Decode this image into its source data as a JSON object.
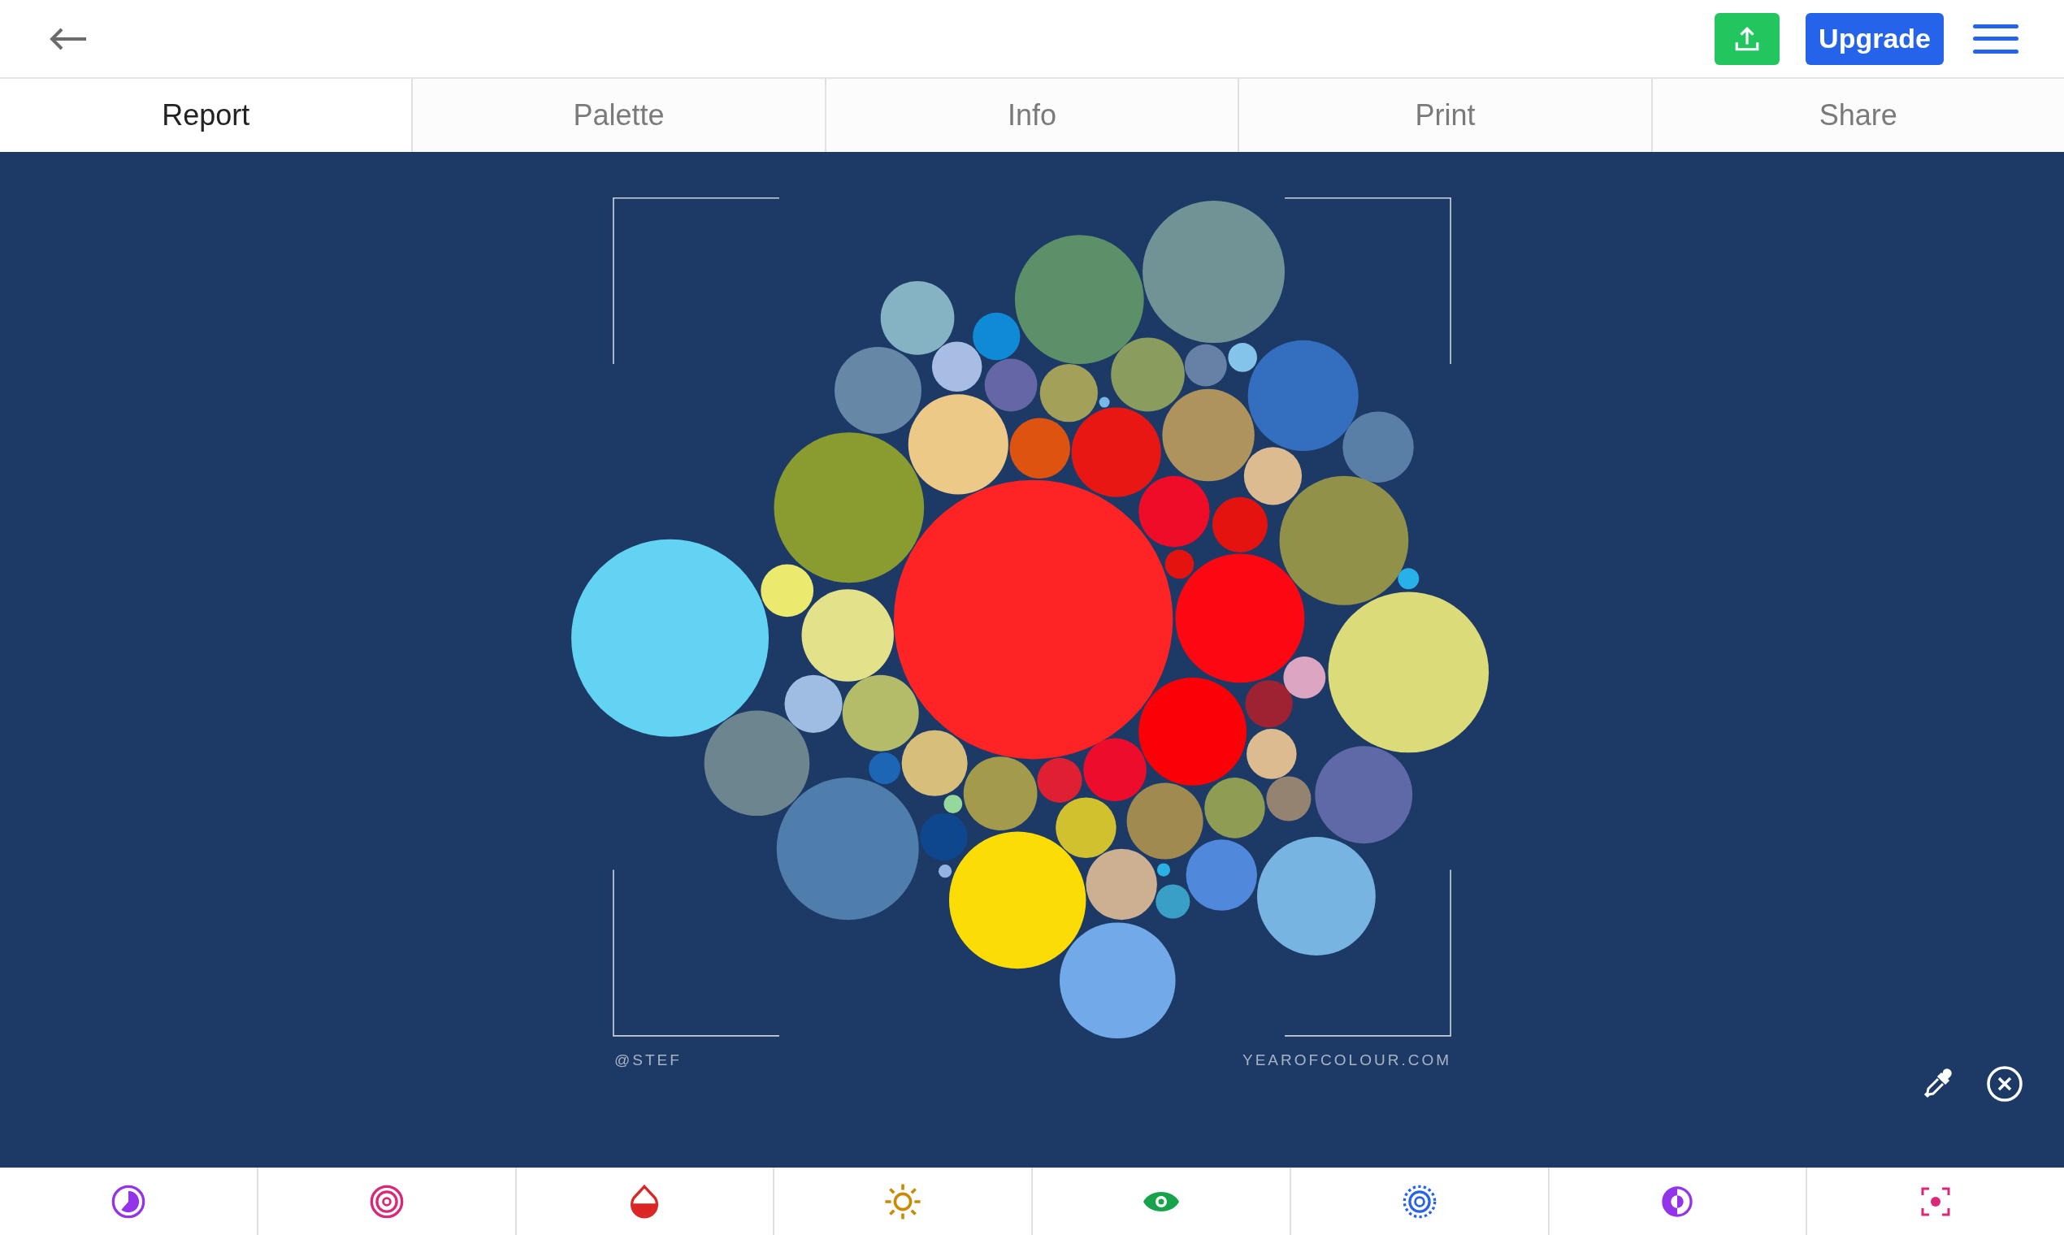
{
  "header": {
    "upgrade_button": "Upgrade"
  },
  "tabs": [
    {
      "label": "Report",
      "selected": true
    },
    {
      "label": "Palette",
      "selected": false
    },
    {
      "label": "Info",
      "selected": false
    },
    {
      "label": "Print",
      "selected": false
    },
    {
      "label": "Share",
      "selected": false
    }
  ],
  "canvas": {
    "author": "@STEF",
    "site": "YEAROFCOLOUR.COM"
  }
}
